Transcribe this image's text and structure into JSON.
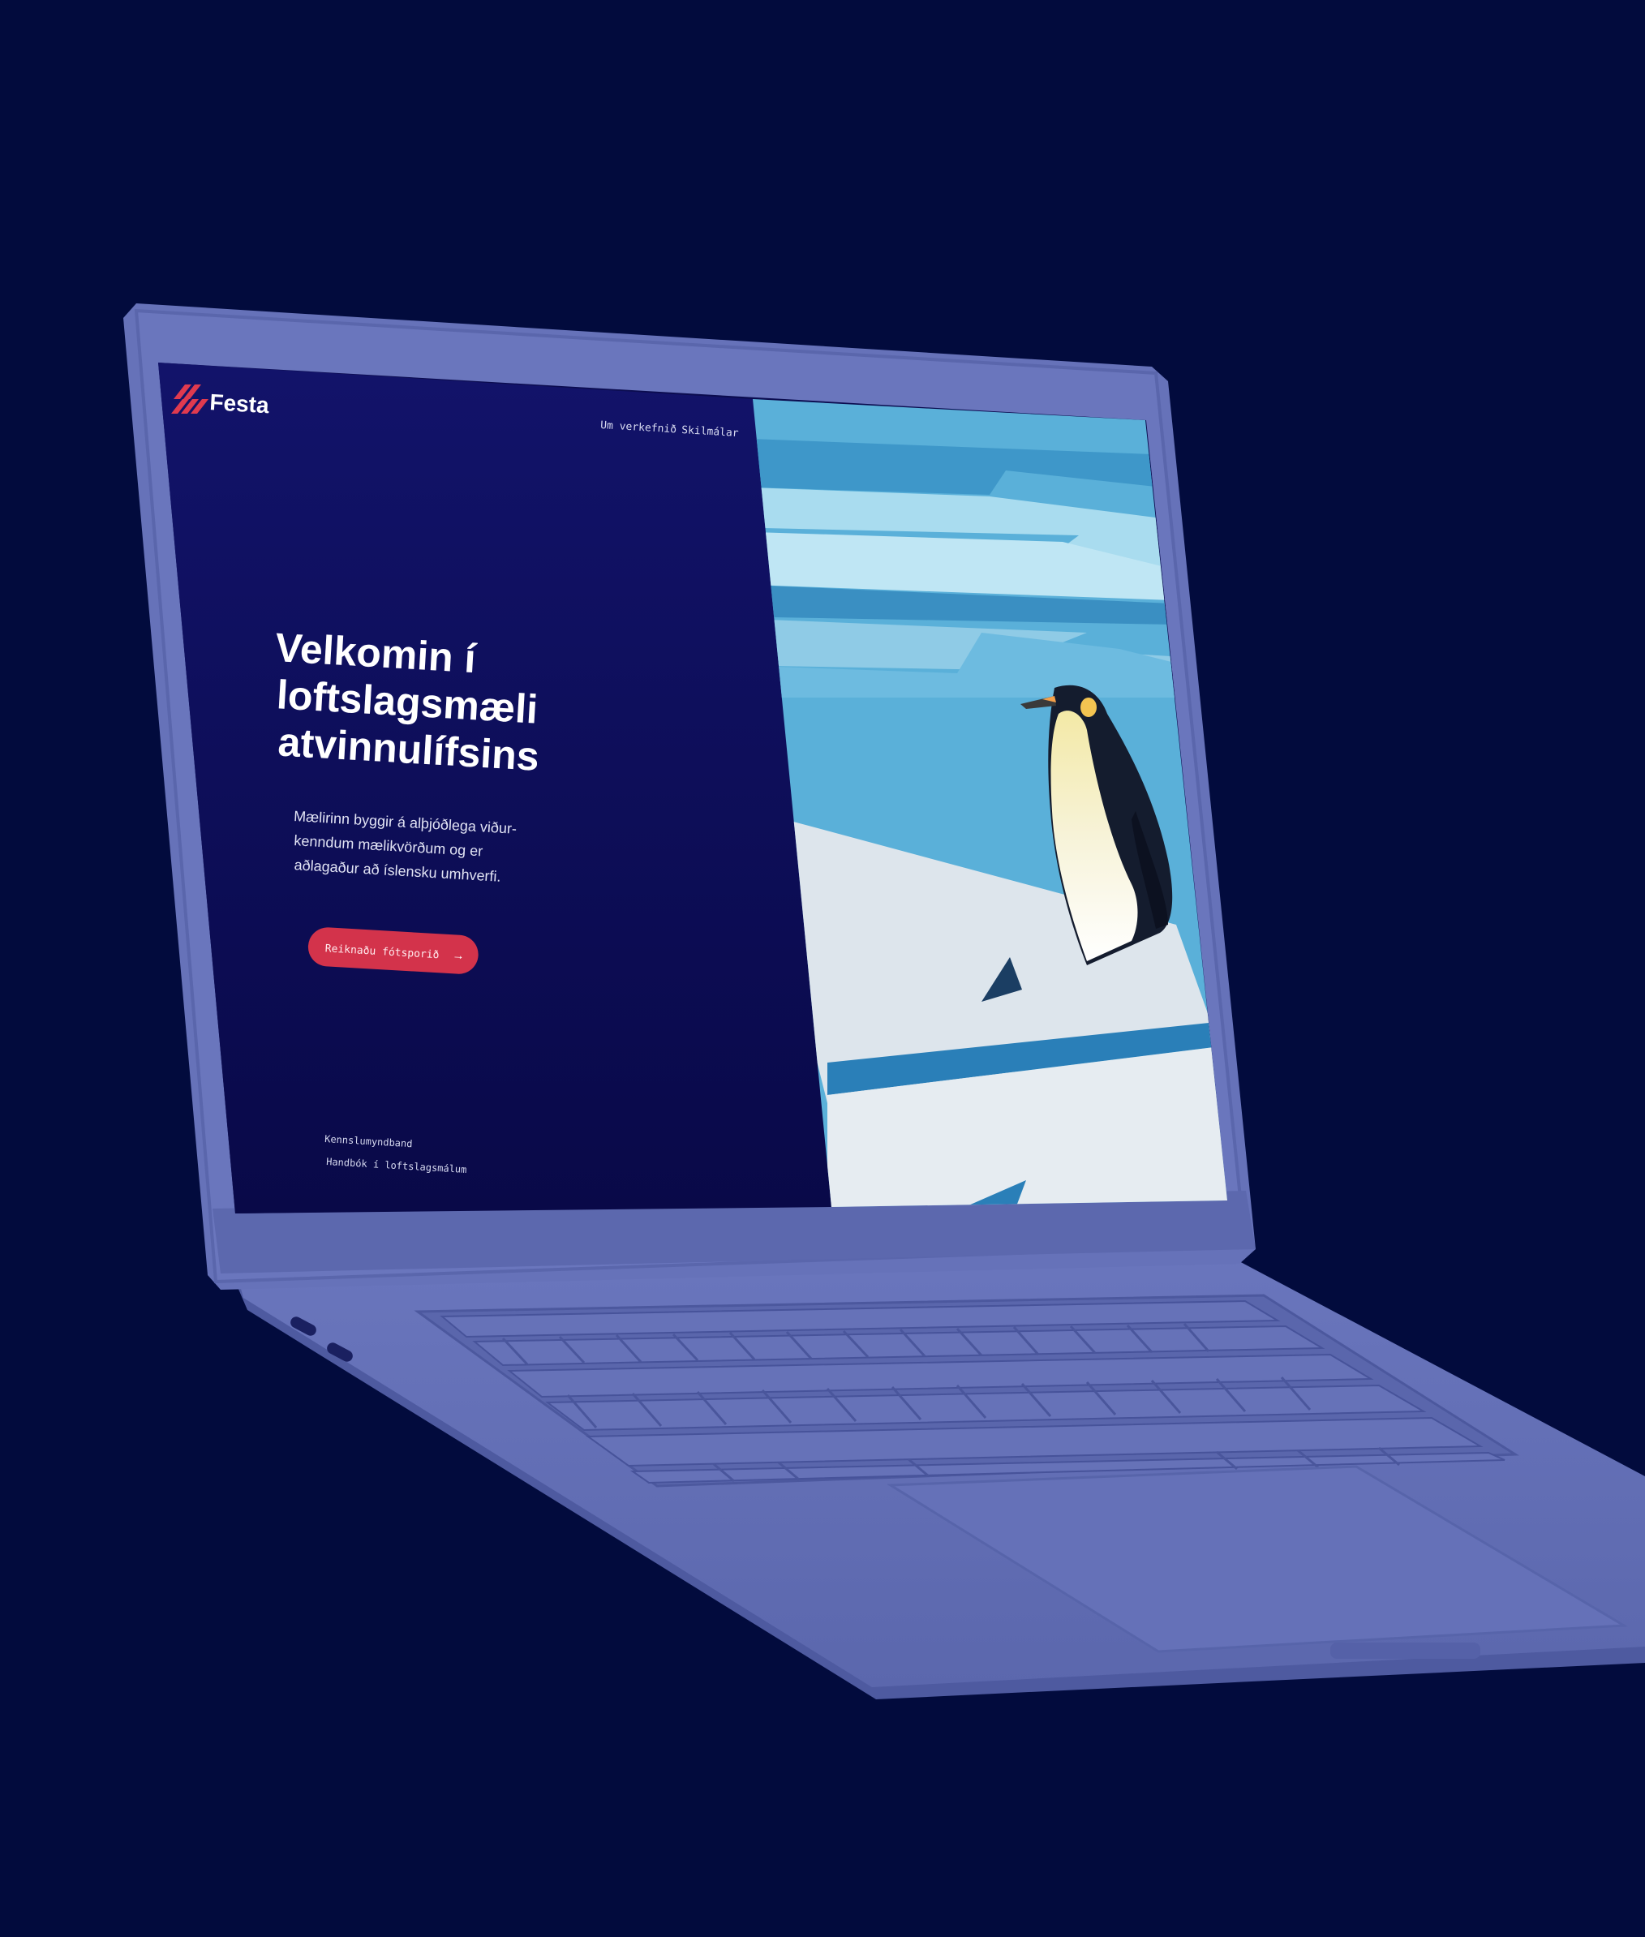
{
  "brand": {
    "name": "Festa",
    "accent": "#e03a4f"
  },
  "nav": {
    "items": [
      {
        "label": "Um verkefnið"
      },
      {
        "label": "Skilmálar"
      }
    ]
  },
  "hero": {
    "title_lines": [
      "Velkomin í",
      "loftslagsmæli",
      "atvinnulífsins"
    ],
    "description_lines": [
      "Mælirinn byggir á alþjóðlega viður-",
      "kenndum mælikvörðum og er",
      "aðlagaður að íslensku umhverfi."
    ],
    "cta_label": "Reiknaðu fótsporið"
  },
  "footer_links": [
    {
      "label": "Kennslumyndband"
    },
    {
      "label": "Handbók í loftslagsmálum"
    }
  ],
  "colors": {
    "page_background": "#020b3d",
    "laptop_body": "#6470b6",
    "screen_panel": "#0e0f5a",
    "sky": "#5ab0d9",
    "ice": "#dde5ec",
    "button": "#d3334b"
  },
  "illustration": {
    "subject": "penguin-on-ice"
  }
}
